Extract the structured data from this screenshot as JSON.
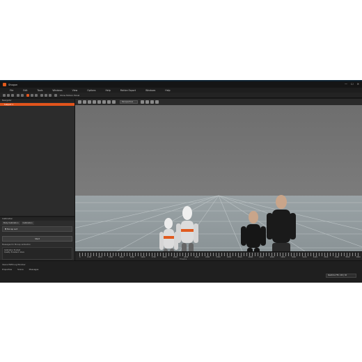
{
  "window": {
    "title": "Shogun",
    "controls": [
      "—",
      "☐",
      "✕"
    ]
  },
  "menu": {
    "items": [
      "File",
      "Edit",
      "Tools",
      "Windows",
      "View",
      "Options",
      "Help",
      "Motion Export",
      "Windows",
      "Help"
    ]
  },
  "toolbar": {
    "option_label": "Show Motion Panel"
  },
  "viewport_tools": {
    "dropdown_value": "Perspective"
  },
  "left_panel": {
    "header": "Navigator",
    "selected_item": "Subject 1",
    "calibration_header": "Calibration",
    "tabs": [
      "Body Calibration",
      "Calibration"
    ],
    "field_value": "▼ Mocap suit",
    "button_label": "Start",
    "messages_label": "Messages for Mocap calibration",
    "messages": [
      "Calibration finished",
      "Quality: Excellent. Solve"
    ]
  },
  "timeline": {
    "numbers": [
      "0",
      "1100",
      "1200",
      "1300",
      "1400",
      "1500",
      "1600",
      "1700",
      "1800",
      "1900",
      "2000",
      "2100",
      "2200",
      "2300",
      "2400",
      "2500",
      "2600",
      "2700",
      "2800",
      "2900",
      "3000",
      "3100",
      "3200",
      "3300",
      "3400",
      "3500",
      "3600"
    ],
    "label": "Timeline"
  },
  "status": {
    "title": "Xsens MVN Log Window",
    "tabs": [
      "Properties",
      "Scene",
      "Messages"
    ],
    "right_text": "Realtime FPS: 240 | 60"
  },
  "colors": {
    "accent": "#e2541c",
    "chrome": "#1b1b1b",
    "floor": "#8f999c"
  }
}
